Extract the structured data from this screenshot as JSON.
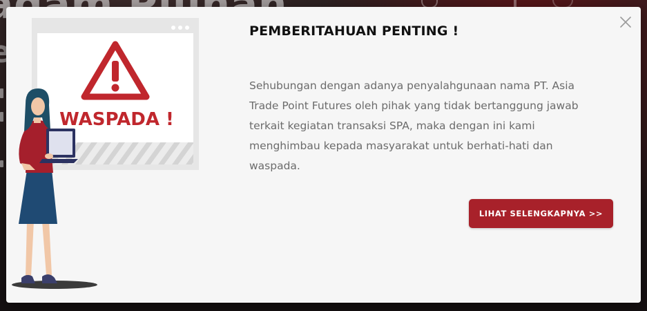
{
  "background": {
    "heading_fragment": "adam Pilihan",
    "letter_fragment": "e"
  },
  "modal": {
    "title": "PEMBERITAHUAN PENTING !",
    "body": "Sehubungan dengan adanya penyalahgunaan nama PT. Asia Trade Point Futures oleh pihak yang tidak bertanggung jawab terkait kegiatan transaksi SPA, maka dengan ini kami menghimbau kepada masyarakat untuk berhati-hati dan waspada.",
    "cta_label": "LIHAT SELENGKAPNYA >>",
    "close_icon": "close-icon"
  },
  "illustration": {
    "warning_text": "WASPADA !",
    "warning_symbol": "!",
    "icons": [
      "warning-triangle-icon",
      "browser-window-icon",
      "laptop-icon"
    ]
  },
  "colors": {
    "accent": "#a8212a",
    "warning_red": "#c0272d",
    "modal_bg": "#f6f6f6",
    "title": "#111111",
    "body_text": "#6b6b6b"
  }
}
